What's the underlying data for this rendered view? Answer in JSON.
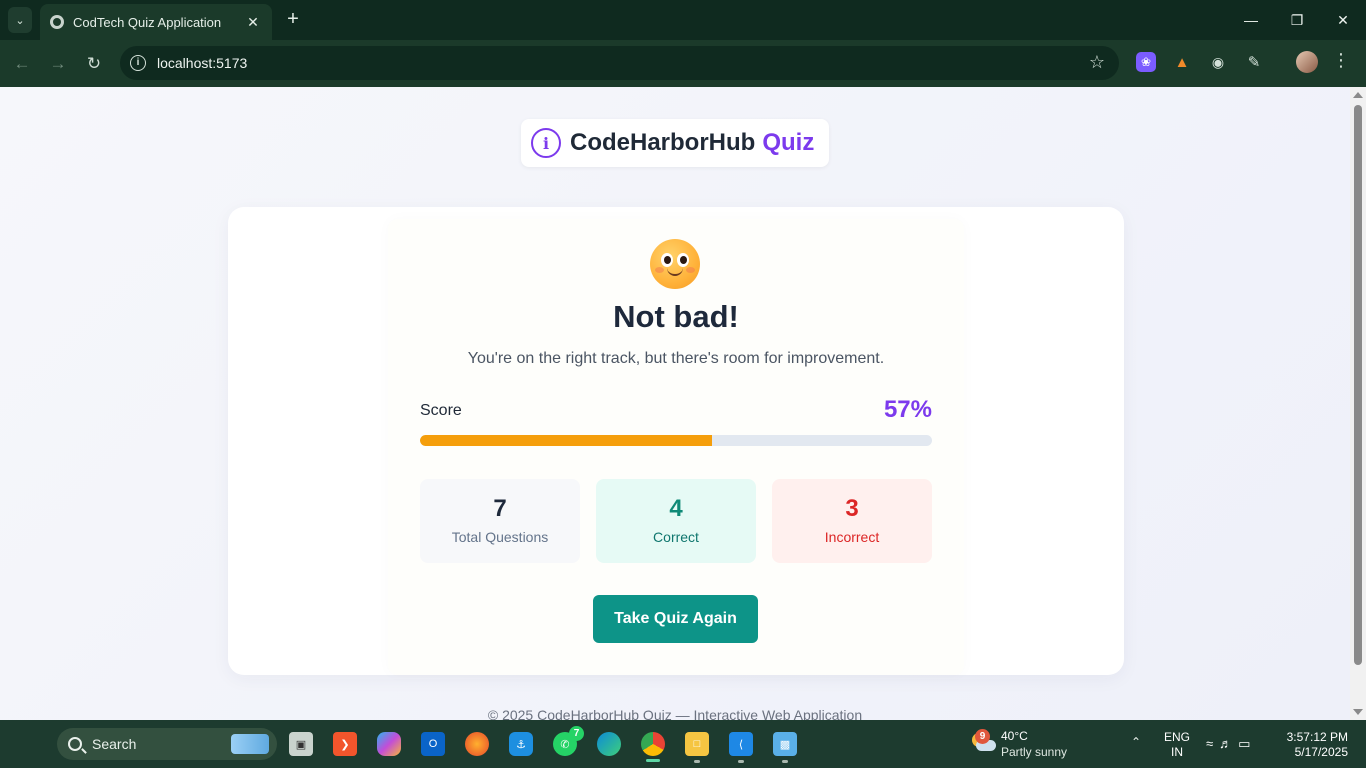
{
  "browser": {
    "tab_title": "CodTech Quiz Application",
    "url": "localhost:5173"
  },
  "page": {
    "brand": {
      "name": "CodeHarborHub",
      "accent": "Quiz"
    },
    "result": {
      "title": "Not bad!",
      "subtitle": "You're on the right track, but there's room for improvement.",
      "score_label": "Score",
      "score_text": "57%",
      "score_fraction": 0.57,
      "stats": {
        "total": {
          "value": "7",
          "label": "Total Questions"
        },
        "correct": {
          "value": "4",
          "label": "Correct"
        },
        "incorrect": {
          "value": "3",
          "label": "Incorrect"
        }
      },
      "retry_label": "Take Quiz Again"
    },
    "footer": "© 2025 CodeHarborHub Quiz — Interactive Web Application"
  },
  "taskbar": {
    "search_label": "Search",
    "whatsapp_badge": "7",
    "weather_badge": "9",
    "weather_temp": "40°C",
    "weather_desc": "Partly sunny",
    "lang_line1": "ENG",
    "lang_line2": "IN",
    "time": "3:57:12 PM",
    "date": "5/17/2025"
  },
  "colors": {
    "accent": "#7c3aed",
    "progress": "#f59e0b",
    "correct": "#0f8a77",
    "incorrect": "#dc2626",
    "button": "#0d9488"
  }
}
